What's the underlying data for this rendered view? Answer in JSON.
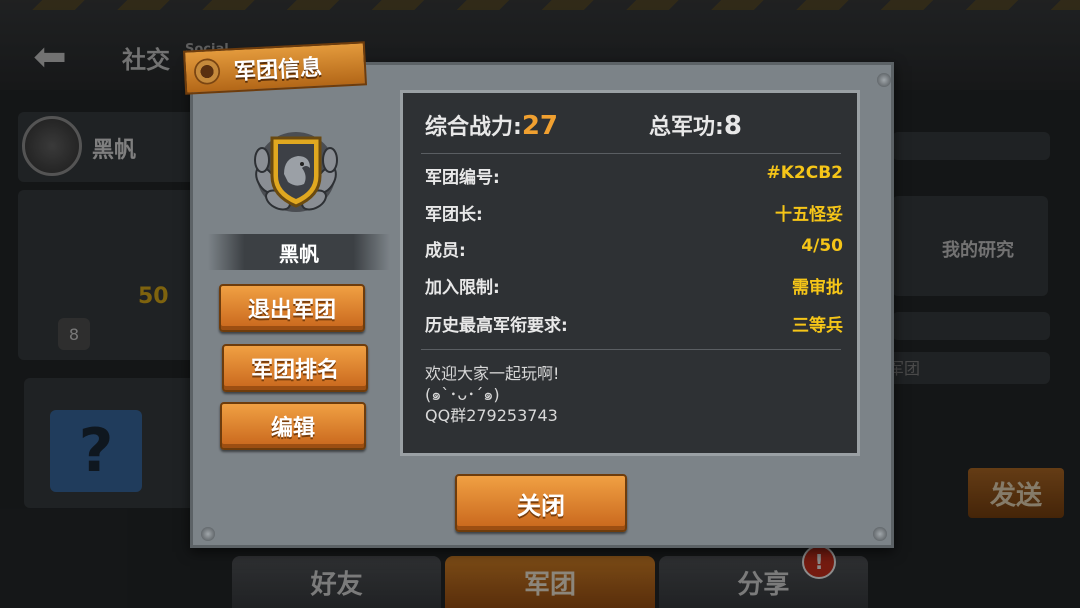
{
  "background": {
    "back_label": "⬅",
    "social_title": "社交",
    "social_subtitle": "Social",
    "guild_name": "黑帆",
    "level_value": "50",
    "level_badge": "8",
    "research_label": "我的研究",
    "send_label": "发送",
    "guild_hint": "军团",
    "mystery_icon": "?"
  },
  "tabs": [
    {
      "label": "好友"
    },
    {
      "label": "军团"
    },
    {
      "label": "分享"
    }
  ],
  "tab_notification": "!",
  "dialog": {
    "title": "军团信息",
    "guild_name": "黑帆",
    "buttons": {
      "quit": "退出军团",
      "ranking": "军团排名",
      "edit": "编辑",
      "close": "关闭"
    },
    "power_label": "综合战力:",
    "power_value": "27",
    "merit_label": "总军功:",
    "merit_value": "8",
    "info": [
      {
        "key": "军团编号:",
        "value": "#K2CB2"
      },
      {
        "key": "军团长:",
        "value": "十五怪妥"
      },
      {
        "key": "成员:",
        "value": "4/50"
      },
      {
        "key": "加入限制:",
        "value": "需审批"
      },
      {
        "key": "历史最高军衔要求:",
        "value": "三等兵"
      }
    ],
    "description": "欢迎大家一起玩啊!\n(๑`･ᴗ･´๑)\nQQ群279253743"
  },
  "colors": {
    "accent_orange": "#e08a2a",
    "value_yellow": "#f5c518",
    "power_orange": "#f0a030"
  }
}
